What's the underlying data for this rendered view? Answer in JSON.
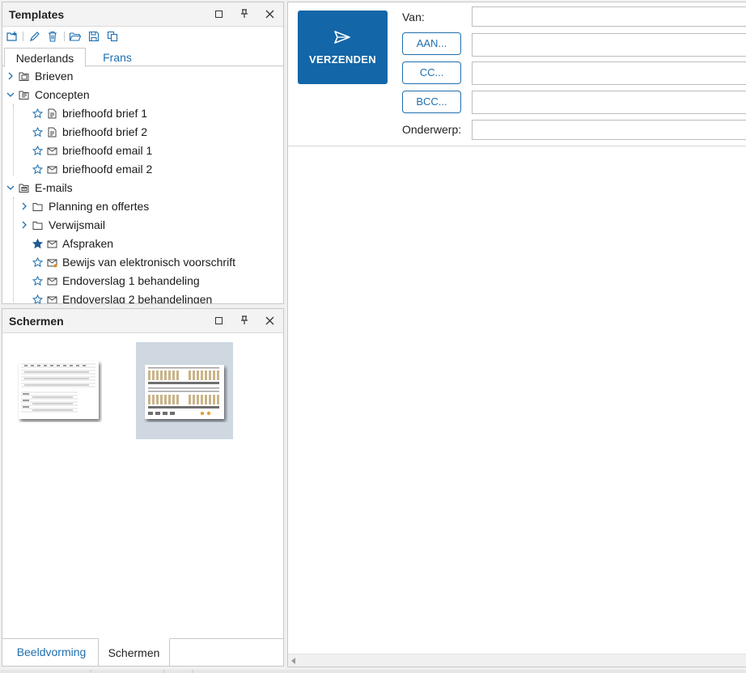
{
  "templates_panel": {
    "title": "Templates",
    "tabs": [
      {
        "label": "Nederlands",
        "active": true
      },
      {
        "label": "Frans",
        "active": false
      }
    ],
    "toolbar_icons": [
      "add-template-icon",
      "edit-icon",
      "delete-icon",
      "open-folder-icon",
      "save-icon",
      "copy-icon"
    ],
    "tree": [
      {
        "label": "Brieven",
        "level": 0,
        "expanded": false,
        "icon": "letter-folder-icon"
      },
      {
        "label": "Concepten",
        "level": 0,
        "expanded": true,
        "icon": "drafts-folder-icon"
      },
      {
        "label": "briefhoofd brief 1",
        "level": 1,
        "icon": "letter-icon",
        "favorite": false
      },
      {
        "label": "briefhoofd brief 2",
        "level": 1,
        "icon": "letter-icon",
        "favorite": false
      },
      {
        "label": "briefhoofd email 1",
        "level": 1,
        "icon": "mail-icon",
        "favorite": false
      },
      {
        "label": "briefhoofd email 2",
        "level": 1,
        "icon": "mail-icon",
        "favorite": false
      },
      {
        "label": "E-mails",
        "level": 0,
        "expanded": true,
        "icon": "mail-folder-icon"
      },
      {
        "label": "Planning en offertes",
        "level": 1,
        "expanded": false,
        "icon": "folder-icon"
      },
      {
        "label": "Verwijsmail",
        "level": 1,
        "expanded": false,
        "icon": "folder-icon"
      },
      {
        "label": "Afspraken",
        "level": 1,
        "icon": "mail-icon",
        "favorite": true
      },
      {
        "label": "Bewijs van elektronisch voorschrift",
        "level": 1,
        "icon": "mail-attachment-icon",
        "favorite": false
      },
      {
        "label": "Endoverslag 1 behandeling",
        "level": 1,
        "icon": "mail-icon",
        "favorite": false
      },
      {
        "label": "Endoverslag 2 behandelingen",
        "level": 1,
        "icon": "mail-icon",
        "favorite": false
      }
    ]
  },
  "screens_panel": {
    "title": "Schermen",
    "thumbnails": [
      {
        "name": "table-screen-thumbnail",
        "selected": false
      },
      {
        "name": "dental-chart-thumbnail",
        "selected": true
      }
    ],
    "bottom_tabs": [
      {
        "label": "Beeldvorming",
        "active": false
      },
      {
        "label": "Schermen",
        "active": true
      }
    ]
  },
  "composer": {
    "send_label": "VERZENDEN",
    "from_label": "Van:",
    "to_button": "AAN...",
    "cc_button": "CC...",
    "bcc_button": "BCC...",
    "subject_label": "Onderwerp:",
    "from_value": "",
    "to_value": "",
    "cc_value": "",
    "bcc_value": "",
    "subject_value": ""
  },
  "colors": {
    "accent": "#1366a8",
    "link_blue": "#1f6fae",
    "panel_border": "#c8c8c8",
    "selection": "#cfd8e1"
  }
}
